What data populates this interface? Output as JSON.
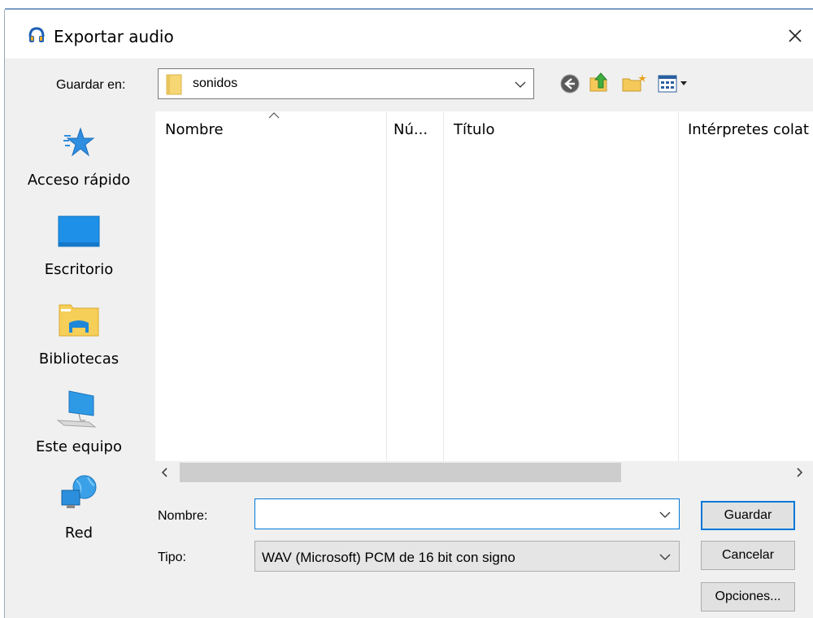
{
  "window": {
    "title": "Exportar audio",
    "close_icon": "close-icon",
    "app_icon": "headphones-icon",
    "accent_color": "#0078d7"
  },
  "save_in": {
    "label": "Guardar en:",
    "value": "sonidos",
    "folder_icon": "folder-icon"
  },
  "toolbar": {
    "icons": [
      "back-icon",
      "up-folder-icon",
      "new-folder-icon",
      "view-menu-icon"
    ]
  },
  "places": [
    {
      "label": "Acceso rápido",
      "icon": "star-icon"
    },
    {
      "label": "Escritorio",
      "icon": "desktop-icon"
    },
    {
      "label": "Bibliotecas",
      "icon": "libraries-icon"
    },
    {
      "label": "Este equipo",
      "icon": "computer-icon"
    },
    {
      "label": "Red",
      "icon": "network-icon"
    }
  ],
  "file_list": {
    "columns": [
      "Nombre",
      "Nú...",
      "Título",
      "Intérpretes colat"
    ],
    "rows": []
  },
  "form": {
    "name_label": "Nombre:",
    "name_value": "",
    "type_label": "Tipo:",
    "type_value": "WAV (Microsoft) PCM de 16 bit con signo"
  },
  "buttons": {
    "save": "Guardar",
    "cancel": "Cancelar",
    "options": "Opciones..."
  }
}
